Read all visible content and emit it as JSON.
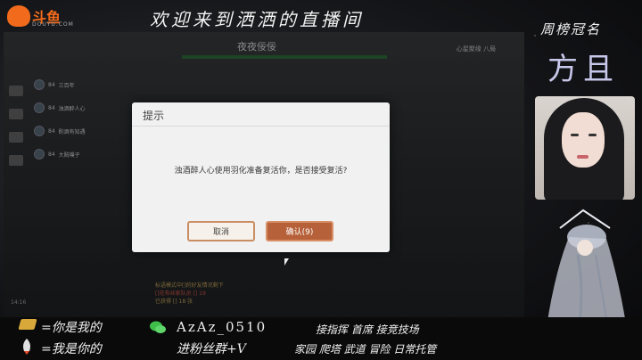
{
  "brand": {
    "name": "斗鱼",
    "domain": "DOUYU.COM",
    "accent": "#f26a1b"
  },
  "banner": {
    "title": "欢迎来到洒洒的直播间"
  },
  "game": {
    "player_name": "夜夜佞佞",
    "right_label": "心星聚缘 八局",
    "team": [
      {
        "level": "84",
        "name": "三百年"
      },
      {
        "level": "84",
        "name": "浊酒醉人心"
      },
      {
        "level": "84",
        "name": "酌酒有知遇"
      },
      {
        "level": "84",
        "name": "大贼噗子"
      }
    ],
    "chat_lines": [
      {
        "text": "标语模式中[]的好友情况剩下",
        "tone": "gold"
      },
      {
        "text": "[]花布丝家队员 [] 19",
        "tone": "red"
      },
      {
        "text": "已获得 [] 18 张",
        "tone": "gold"
      }
    ],
    "time": "14:16"
  },
  "dialog": {
    "title": "提示",
    "message": "浊酒醉人心使用羽化准备复活你，是否接受复活?",
    "cancel_label": "取消",
    "confirm_label": "确认(9)"
  },
  "side": {
    "weekly_title": "周榜冠名",
    "champion_name": "方且"
  },
  "bottom": {
    "row1_left": "=你是我的",
    "row2_left": "=我是你的",
    "wechat_id": "AzAz_0510",
    "fan_group": "进粉丝群+V",
    "services_1": "接指挥  首席  接竞技场",
    "services_2": "家园  爬塔  武道  冒险  日常托管"
  }
}
